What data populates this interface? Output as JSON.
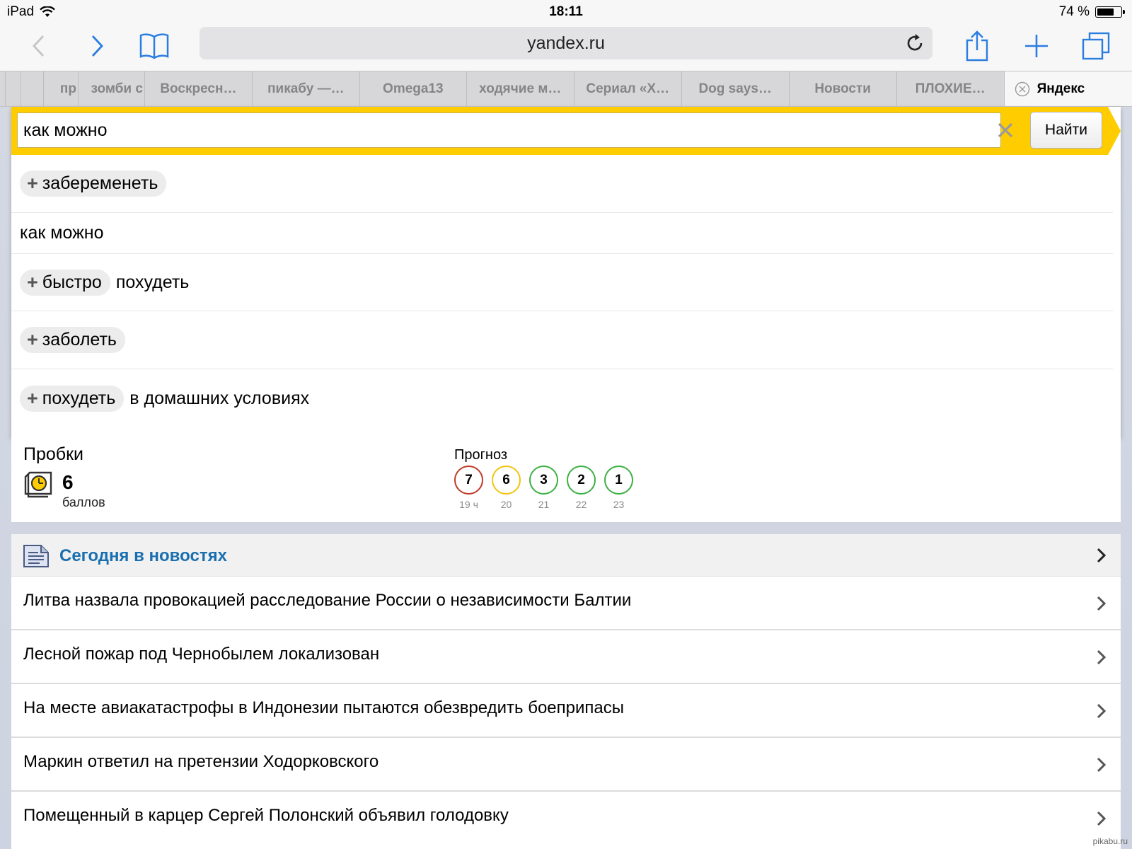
{
  "status_bar": {
    "device": "iPad",
    "time": "18:11",
    "battery_text": "74 %",
    "battery_level": 0.74
  },
  "toolbar": {
    "url": "yandex.ru",
    "icons": [
      "back-icon",
      "forward-icon",
      "bookmarks-icon",
      "reload-icon",
      "share-icon",
      "new-tab-icon",
      "tabs-icon"
    ]
  },
  "tabs": {
    "items": [
      {
        "label": "пр"
      },
      {
        "label": "зомби с"
      },
      {
        "label": "Воскресн…"
      },
      {
        "label": "пикабу —…"
      },
      {
        "label": "Omega13"
      },
      {
        "label": "ходячие м…"
      },
      {
        "label": "Сериал «Х…"
      },
      {
        "label": "Dog says…"
      },
      {
        "label": "Новости"
      },
      {
        "label": "ПЛОХИЕ…"
      }
    ],
    "active": {
      "label": "Яндекс"
    }
  },
  "search": {
    "query": "как можно",
    "button_label": "Найти",
    "accent": "#ffcc00",
    "suggestions": [
      {
        "chip": "забеременеть",
        "text": ""
      },
      {
        "chip": "",
        "text": "как можно"
      },
      {
        "chip": "быстро",
        "text": "похудеть"
      },
      {
        "chip": "заболеть",
        "text": ""
      },
      {
        "chip": "похудеть",
        "text": "в домашних условиях"
      }
    ]
  },
  "traffic": {
    "title": "Пробки",
    "score": "6",
    "unit": "баллов",
    "forecast_title": "Прогноз",
    "forecast": [
      {
        "value": "7",
        "hour": "19 ч",
        "color": "#c0392b"
      },
      {
        "value": "6",
        "hour": "20",
        "color": "#f1c40f"
      },
      {
        "value": "3",
        "hour": "21",
        "color": "#3cb043"
      },
      {
        "value": "2",
        "hour": "22",
        "color": "#3cb043"
      },
      {
        "value": "1",
        "hour": "23",
        "color": "#3cb043"
      }
    ]
  },
  "news": {
    "title": "Сегодня в новостях",
    "title_color": "#1a6fb0",
    "items": [
      "Литва назвала провокацией расследование России о независимости Балтии",
      "Лесной пожар под Чернобылем локализован",
      "На месте авиакатастрофы в Индонезии пытаются обезвредить боеприпасы",
      "Маркин ответил на претензии Ходорковского",
      "Помещенный в карцер Сергей Полонский объявил голодовку"
    ]
  },
  "watermark": "pikabu.ru"
}
